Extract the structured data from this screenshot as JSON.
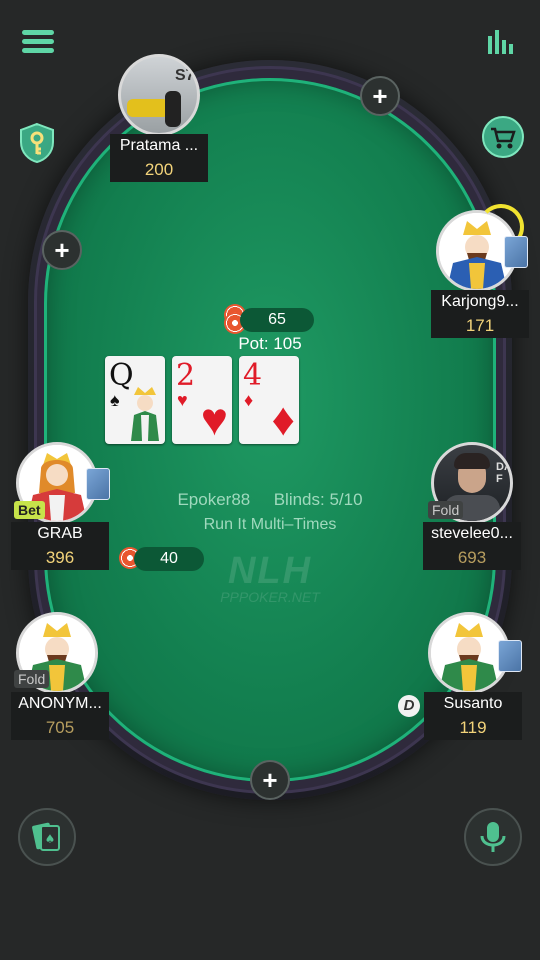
{
  "table": {
    "pot_bet": "65",
    "pot_label": "Pot: 105",
    "game_info": "Epoker88",
    "blinds": "Blinds: 5/10",
    "run_it": "Run It Multi–Times",
    "watermark": "NLH",
    "watermark_site": "PPPOKER.NET",
    "community_cards": [
      {
        "rank": "Q",
        "suit": "♠",
        "color": "black"
      },
      {
        "rank": "2",
        "suit": "♥",
        "color": "red"
      },
      {
        "rank": "4",
        "suit": "♦",
        "color": "red"
      }
    ]
  },
  "players": {
    "pratama": {
      "name": "Pratama ...",
      "stack": "200"
    },
    "karjong": {
      "name": "Karjong9...",
      "stack": "171"
    },
    "grab": {
      "name": "GRAB",
      "stack": "396",
      "status": "Bet",
      "bet": "40"
    },
    "stevelee": {
      "name": "stevelee0...",
      "stack": "693",
      "status": "Fold"
    },
    "anonym": {
      "name": "ANONYM...",
      "stack": "705",
      "status": "Fold"
    },
    "susanto": {
      "name": "Susanto",
      "stack": "119",
      "dealer": "D"
    }
  },
  "icons": {
    "menu": "menu-icon",
    "stats": "bar-chart-icon",
    "security": "shield-key-icon",
    "shop": "cart-icon",
    "cards": "cards-icon",
    "mic": "microphone-icon"
  },
  "colors": {
    "felt": "#138050",
    "stack": "#f2d37a",
    "accent": "#6fe0b4"
  }
}
